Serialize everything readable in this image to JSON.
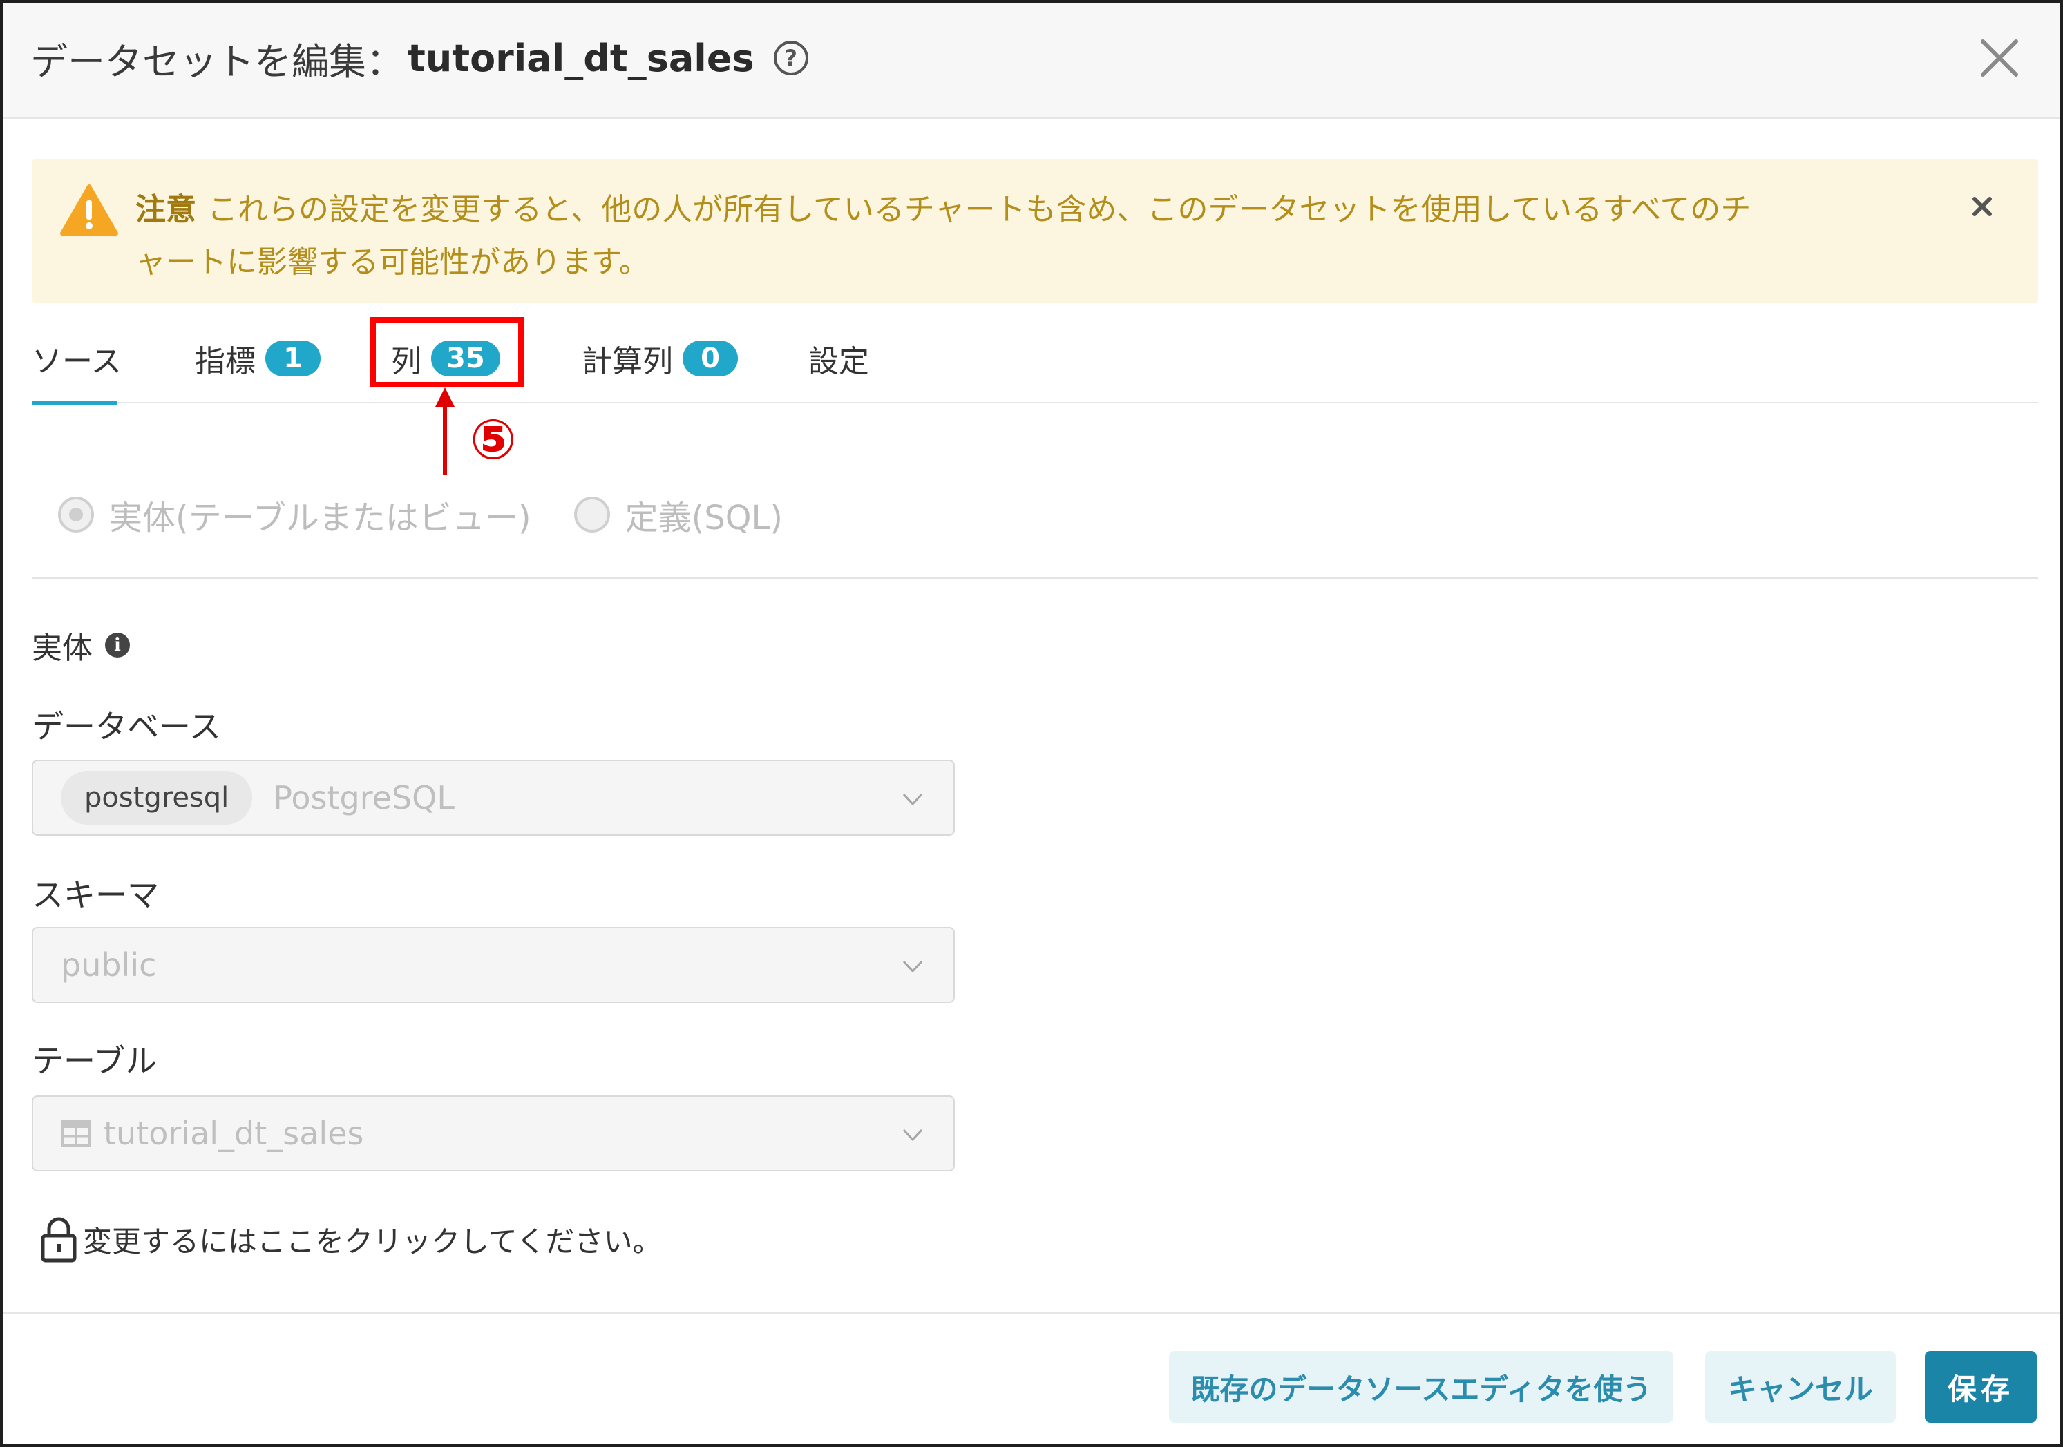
{
  "dialog": {
    "title_prefix": "データセットを編集：",
    "dataset_name": "tutorial_dt_sales",
    "help_glyph": "?"
  },
  "alert": {
    "strong": "注意",
    "line1": "これらの設定を変更すると、他の人が所有しているチャートも含め、このデータセットを使用しているすべてのチ",
    "line2": "ャートに影響する可能性があります。"
  },
  "tabs": [
    {
      "label": "ソース",
      "badge": null,
      "active": true
    },
    {
      "label": "指標",
      "badge": "1"
    },
    {
      "label": "列",
      "badge": "35"
    },
    {
      "label": "計算列",
      "badge": "0"
    },
    {
      "label": "設定",
      "badge": null
    }
  ],
  "annotation": {
    "number": "⑤",
    "color": "#ff0000"
  },
  "source_type": {
    "options": [
      {
        "label": "実体(テーブルまたはビュー)",
        "checked": true
      },
      {
        "label": "定義(SQL)",
        "checked": false
      }
    ]
  },
  "physical": {
    "section_label": "実体",
    "info_glyph": "i",
    "database": {
      "label": "データベース",
      "tag": "postgresql",
      "value": "PostgreSQL"
    },
    "schema": {
      "label": "スキーマ",
      "value": "public"
    },
    "table": {
      "label": "テーブル",
      "value": "tutorial_dt_sales"
    }
  },
  "lock_message": "変更するにはここをクリックしてください。",
  "footer": {
    "legacy_button": "既存のデータソースエディタを使う",
    "cancel_button": "キャンセル",
    "save_button": "保存"
  },
  "colors": {
    "accent": "#20a7c9",
    "primary_button": "#1a85a6",
    "alert_bg": "#fcf6e1",
    "alert_text": "#b48e1a",
    "annotation_red": "#ff0000"
  }
}
